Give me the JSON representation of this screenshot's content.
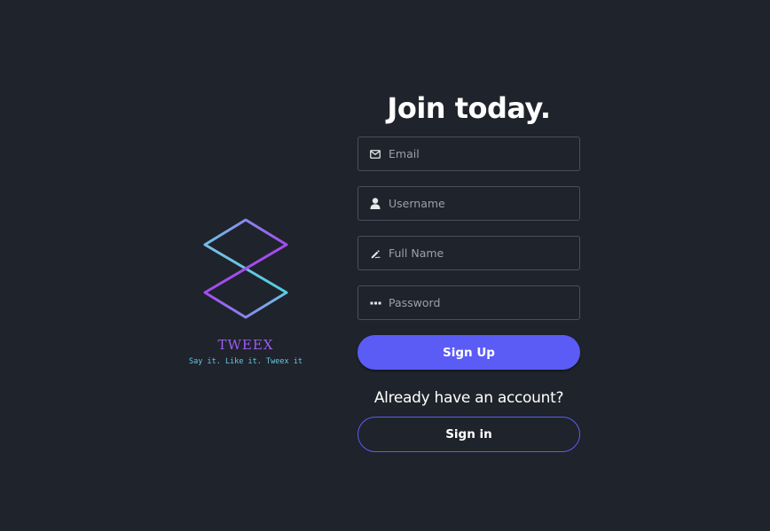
{
  "brand": {
    "name": "TWEEX",
    "tagline": "Say it. Like it. Tweex it",
    "logo_icon": "hexagon-cube-logo",
    "colors": {
      "logo_purple": "#9d5cf6",
      "logo_cyan": "#5ec8e5",
      "name": "#9d5cf6",
      "tagline": "#66c8e6"
    }
  },
  "form": {
    "heading": "Join today.",
    "fields": {
      "email": {
        "placeholder": "Email",
        "value": "",
        "icon": "mail-icon"
      },
      "username": {
        "placeholder": "Username",
        "value": "",
        "icon": "user-icon"
      },
      "full_name": {
        "placeholder": "Full Name",
        "value": "",
        "icon": "signature-icon"
      },
      "password": {
        "placeholder": "Password",
        "value": "",
        "icon": "password-dots-icon"
      }
    },
    "signup_label": "Sign Up",
    "already_text": "Already have an account?",
    "signin_label": "Sign in"
  },
  "colors": {
    "background": "#1f232b",
    "accent": "#5b5cf6",
    "field_border": "#4a5059",
    "placeholder": "#9aa1ab"
  }
}
